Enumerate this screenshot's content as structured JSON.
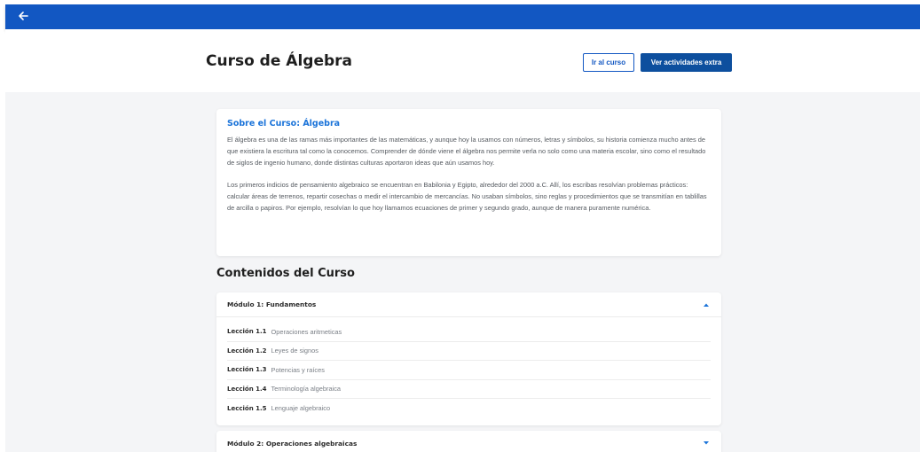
{
  "topbar": {
    "back_icon": "arrow-left-icon",
    "color": "#1257c2"
  },
  "header": {
    "title": "Curso de Álgebra",
    "go_course_label": "Ir al curso",
    "extra_label": "Ver actividades extra"
  },
  "about": {
    "title": "Sobre el Curso: Álgebra",
    "paragraphs": [
      "El álgebra es una de las ramas más importantes de las matemáticas, y aunque hoy la usamos con números, letras y símbolos, su historia comienza mucho antes de que existiera la escritura tal como la conocemos. Comprender de dónde viene el álgebra nos permite verla no solo como una materia escolar, sino como el resultado de siglos de ingenio humano, donde distintas culturas aportaron ideas que aún usamos hoy.",
      "Los primeros indicios de pensamiento algebraico se encuentran en Babilonia y Egipto, alrededor del 2000 a.C. Allí, los escribas resolvían problemas prácticos: calcular áreas de terrenos, repartir cosechas o medir el intercambio de mercancías. No usaban símbolos, sino reglas y procedimientos que se transmitían en tablillas de arcilla o papiros. Por ejemplo, resolvían lo que hoy llamamos ecuaciones de primer y segundo grado, aunque de manera puramente numérica."
    ]
  },
  "contents": {
    "title": "Contenidos del Curso",
    "modules": [
      {
        "title": "Módulo 1: Fundamentos",
        "expanded": true,
        "chevron_icon": "chevron-up-icon",
        "lessons": [
          {
            "num": "Lección 1.1",
            "name": "Operaciones aritmeticas"
          },
          {
            "num": "Lección 1.2",
            "name": "Leyes de signos"
          },
          {
            "num": "Lección 1.3",
            "name": "Potencias y raíces"
          },
          {
            "num": "Lección 1.4",
            "name": "Terminología algebraica"
          },
          {
            "num": "Lección 1.5",
            "name": "Lenguaje algebraico"
          }
        ]
      },
      {
        "title": "Módulo 2: Operaciones algebraicas",
        "expanded": false,
        "chevron_icon": "chevron-down-icon",
        "lessons": []
      }
    ]
  },
  "colors": {
    "accent": "#1a73d9",
    "primary": "#0d4f9e",
    "background": "#f4f5f7"
  }
}
